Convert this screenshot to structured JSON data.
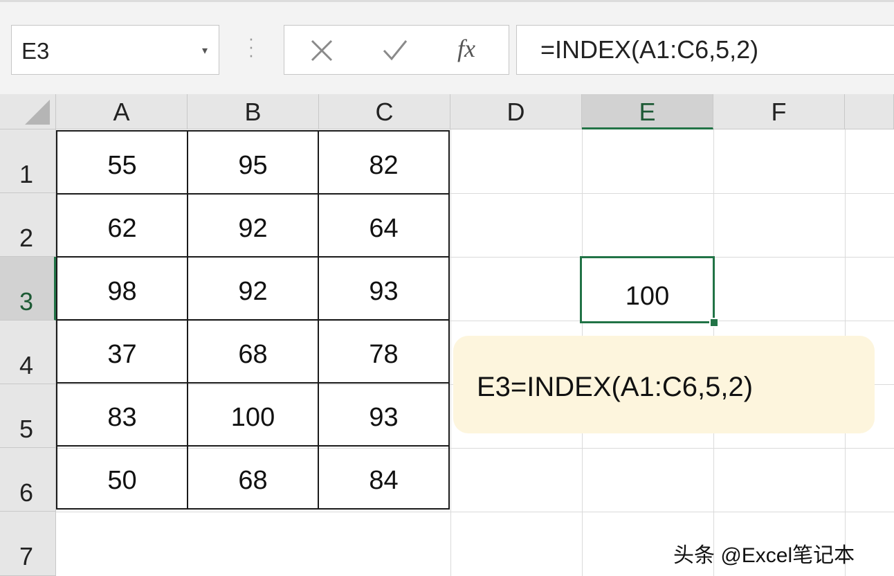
{
  "formula_bar": {
    "name_box": "E3",
    "name_box_dropdown_icon": "chevron-down-icon",
    "more_icon": "vertical-ellipsis-icon",
    "cancel_icon": "close-icon",
    "enter_icon": "checkmark-icon",
    "fx_label": "fx",
    "formula": "=INDEX(A1:C6,5,2)"
  },
  "grid": {
    "columns": [
      "A",
      "B",
      "C",
      "D",
      "E",
      "F"
    ],
    "rows": [
      "1",
      "2",
      "3",
      "4",
      "5",
      "6",
      "7"
    ],
    "active_column": "E",
    "active_row": "3",
    "table": [
      [
        "55",
        "95",
        "82"
      ],
      [
        "62",
        "92",
        "64"
      ],
      [
        "98",
        "92",
        "93"
      ],
      [
        "37",
        "68",
        "78"
      ],
      [
        "83",
        "100",
        "93"
      ],
      [
        "50",
        "68",
        "84"
      ]
    ],
    "active_cell_value": "100"
  },
  "callout": {
    "text": "E3=INDEX(A1:C6,5,2)"
  },
  "watermark": "头条 @Excel笔记本",
  "colors": {
    "accent": "#217346",
    "header_bg": "#e6e6e6",
    "callout_bg": "#fdf5dd"
  }
}
